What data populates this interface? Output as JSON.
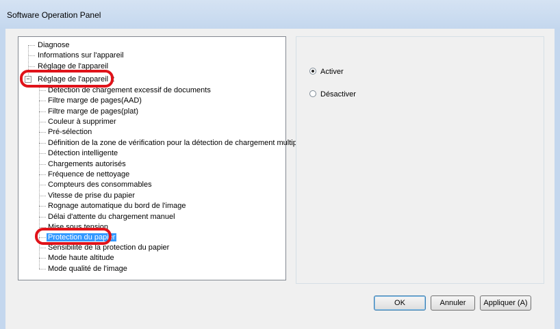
{
  "window": {
    "title": "Software Operation Panel"
  },
  "tree": {
    "items": [
      {
        "label": "Diagnose"
      },
      {
        "label": "Informations sur l'appareil"
      },
      {
        "label": "Réglage de l'appareil"
      },
      {
        "label": "Réglage de l'appareil 2",
        "expanded": true
      },
      {
        "label": "Détection de chargement excessif de documents"
      },
      {
        "label": "Filtre marge de pages(AAD)"
      },
      {
        "label": "Filtre marge de pages(plat)"
      },
      {
        "label": "Couleur à supprimer"
      },
      {
        "label": "Pré-sélection"
      },
      {
        "label": "Définition de la zone de vérification pour la détection de chargement multiple"
      },
      {
        "label": "Détection intelligente"
      },
      {
        "label": "Chargements autorisés"
      },
      {
        "label": "Fréquence de nettoyage"
      },
      {
        "label": "Compteurs des consommables"
      },
      {
        "label": "Vitesse de prise du papier"
      },
      {
        "label": "Rognage automatique du bord de l'image"
      },
      {
        "label": "Délai d'attente du chargement manuel"
      },
      {
        "label": "Mise sous tension"
      },
      {
        "label": "Protection du papier",
        "selected": true
      },
      {
        "label": "Sensibilité de la protection du papier"
      },
      {
        "label": "Mode haute altitude"
      },
      {
        "label": "Mode qualité de l'image"
      }
    ]
  },
  "options": {
    "activer": {
      "label": "Activer",
      "checked": true
    },
    "desactiver": {
      "label": "Désactiver",
      "checked": false
    }
  },
  "buttons": {
    "ok": "OK",
    "cancel": "Annuler",
    "apply": "Appliquer (A)"
  },
  "colors": {
    "selection": "#3399ff",
    "annotation": "#e0131a"
  }
}
